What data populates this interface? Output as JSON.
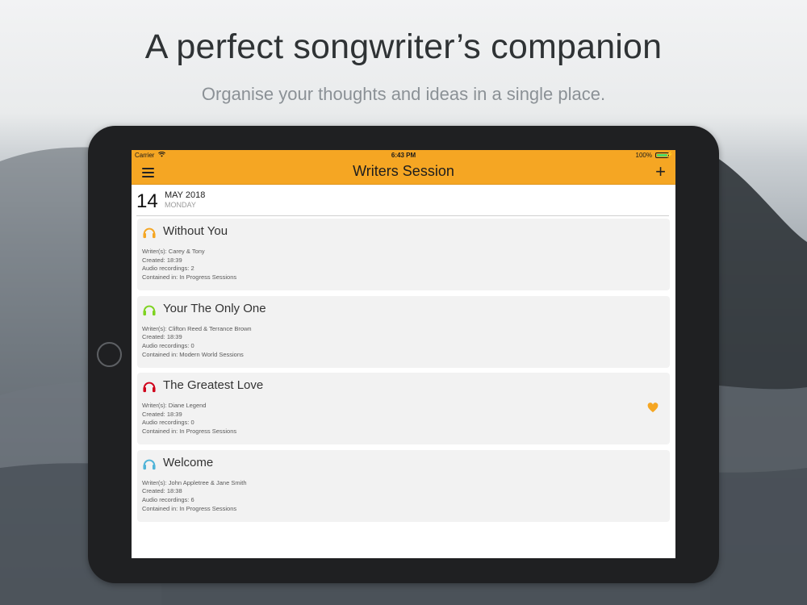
{
  "promo": {
    "title": "A perfect songwriter’s companion",
    "subtitle": "Organise your thoughts and ideas in a single place."
  },
  "status_bar": {
    "carrier": "Carrier",
    "time": "6:43 PM",
    "battery": "100%"
  },
  "nav": {
    "title": "Writers Session",
    "add_symbol": "+"
  },
  "date_header": {
    "day": "14",
    "month_year": "MAY 2018",
    "weekday": "MONDAY"
  },
  "sessions": [
    {
      "title": "Without You",
      "icon": "headphones-icon",
      "icon_color": "#f5a623",
      "writers": "Writer(s): Carey & Tony",
      "created": "Created: 18:39",
      "audio": "Audio recordings: 2",
      "contained": "Contained in: In Progress Sessions",
      "favorite": false
    },
    {
      "title": "Your The Only One",
      "icon": "headphones-icon",
      "icon_color": "#7ed321",
      "writers": "Writer(s): Clifton Reed & Terrance Brown",
      "created": "Created: 18:39",
      "audio": "Audio recordings: 0",
      "contained": "Contained in: Modern World Sessions",
      "favorite": false
    },
    {
      "title": "The Greatest Love",
      "icon": "headphones-icon",
      "icon_color": "#d0021b",
      "writers": "Writer(s): Diane Legend",
      "created": "Created: 18:39",
      "audio": "Audio recordings: 0",
      "contained": "Contained in: In Progress Sessions",
      "favorite": true,
      "favorite_color": "#f5a623"
    },
    {
      "title": "Welcome",
      "icon": "headphones-icon",
      "icon_color": "#50b4d8",
      "writers": "Writer(s): John Appletree & Jane Smith",
      "created": "Created: 18:38",
      "audio": "Audio recordings: 6",
      "contained": "Contained in: In Progress Sessions",
      "favorite": false
    }
  ],
  "colors": {
    "accent": "#f5a623",
    "card_background": "#f2f2f2"
  }
}
